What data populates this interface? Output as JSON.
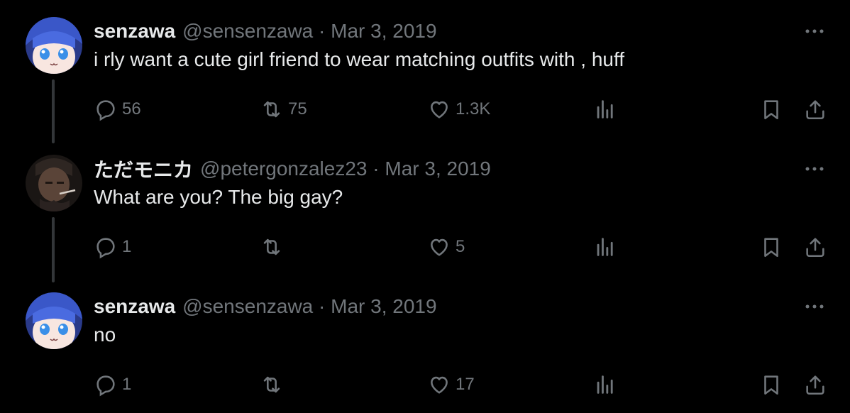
{
  "tweets": [
    {
      "name": "senzawa",
      "meta": "@sensenzawa · Mar 3, 2019",
      "text": "i rly want a cute girl friend to wear matching outfits with , huff",
      "replies": "56",
      "retweets": "75",
      "likes": "1.3K"
    },
    {
      "name": "ただモニカ",
      "meta": "@petergonzalez23 · Mar 3, 2019",
      "text": "What are you? The big gay?",
      "replies": "1",
      "retweets": "",
      "likes": "5"
    },
    {
      "name": "senzawa",
      "meta": "@sensenzawa · Mar 3, 2019",
      "text": "no",
      "replies": "1",
      "retweets": "",
      "likes": "17"
    }
  ],
  "colors": {
    "background": "#000000",
    "text": "#e7e9ea",
    "secondary": "#71767b",
    "thread_line": "#333639"
  },
  "icons": [
    "reply-icon",
    "retweet-icon",
    "like-icon",
    "views-icon",
    "bookmark-icon",
    "share-icon",
    "more-icon"
  ]
}
